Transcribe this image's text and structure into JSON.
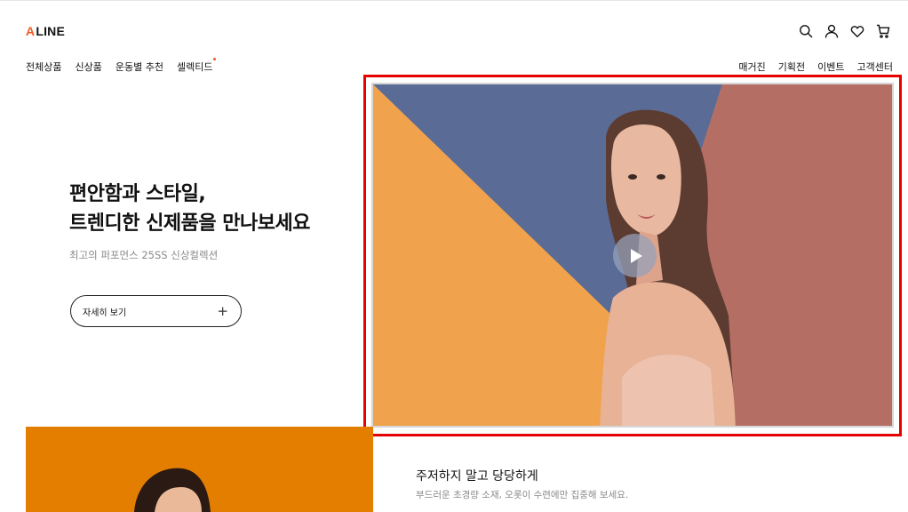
{
  "brand": {
    "logo_a": "A",
    "logo_rest": "LINE",
    "accent_color": "#f15a22"
  },
  "header_icons": [
    "search-icon",
    "user-icon",
    "heart-icon",
    "cart-icon"
  ],
  "nav_left": [
    {
      "label": "전체상품"
    },
    {
      "label": "신상품"
    },
    {
      "label": "운동별 추천"
    },
    {
      "label": "셀렉티드"
    }
  ],
  "nav_right": [
    {
      "label": "매거진"
    },
    {
      "label": "기획전"
    },
    {
      "label": "이벤트"
    },
    {
      "label": "고객센터"
    }
  ],
  "hero": {
    "title_line1": "편안함과 스타일,",
    "title_line2": "트렌디한 신제품을 만나보세요",
    "subtitle": "최고의 퍼포먼스 25SS 신상컬렉션",
    "button_label": "자세히 보기",
    "button_icon": "+"
  },
  "video": {
    "highlight_color": "#e60000",
    "background_colors": [
      "#f0a24c",
      "#5a6b96",
      "#b56e63"
    ]
  },
  "promo": {
    "title": "주저하지 말고 당당하게",
    "description": "부드러운 초경량 소재, 오롯이 수련에만 집중해 보세요.",
    "image_color": "#e37e00"
  }
}
